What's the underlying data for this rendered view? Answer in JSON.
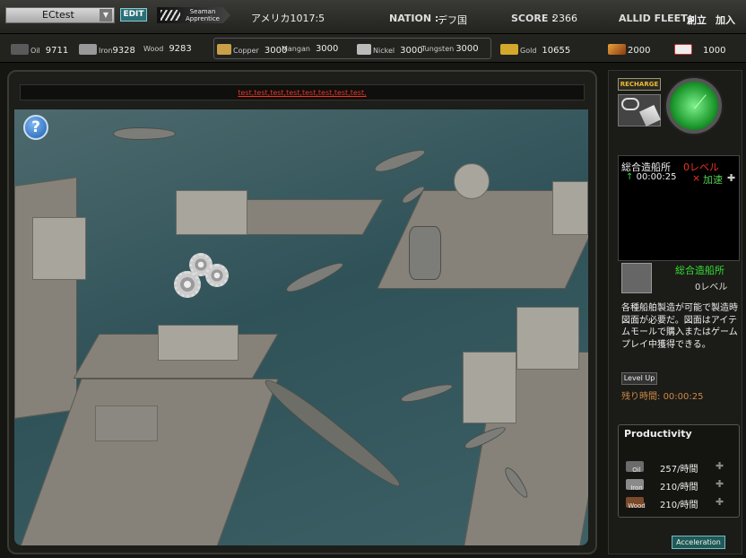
{
  "topbar": {
    "player_name": "ECtest",
    "edit_label": "EDIT",
    "rank_line1": "Seaman",
    "rank_line2": "Apprentice",
    "location": "アメリカ1017:5",
    "nation_label": "NATION :",
    "nation_value": "デフ国",
    "score_label": "SCORE :",
    "score_value": "2366",
    "fleet_label": "ALLID FLEET :",
    "fleet_create": "創立",
    "fleet_join": "加入"
  },
  "resources": {
    "oil": {
      "label": "Oil",
      "value": "9711"
    },
    "iron": {
      "label": "Iron",
      "value": "9328"
    },
    "wood": {
      "label": "Wood",
      "value": "9283"
    },
    "copper": {
      "label": "Copper",
      "value": "3000"
    },
    "mangan": {
      "label": "Mangan",
      "value": "3000"
    },
    "nickel": {
      "label": "Nickel",
      "value": "3000"
    },
    "tungsten": {
      "label": "Tungsten",
      "value": "3000"
    },
    "gold": {
      "label": "Gold",
      "value": "10655"
    },
    "item1_value": "2000",
    "item2_value": "1000"
  },
  "ticker": "test,test,test,test,test,test,test,test,",
  "help_label": "?",
  "panel": {
    "recharge_label": "RECHARGE",
    "queue_name": "総合造船所",
    "queue_level": "0レベル",
    "queue_arrow": "↑",
    "queue_time": "00:00:25",
    "queue_cancel": "×",
    "queue_boost": "加速",
    "queue_plus": "✚",
    "building_name": "総合造船所",
    "building_level": "0レベル",
    "description": "各種船舶製造が可能で製造時図面が必要だ。図面はアイテムモールで購入またはゲームプレイ中獲得できる。",
    "levelup_label": "Level Up",
    "remaining_label": "残り時間:",
    "remaining_time": "00:00:25",
    "productivity_title": "Productivity",
    "productivity": [
      {
        "label": "Oil",
        "value": "257/時間",
        "color": "#6b6b6b"
      },
      {
        "label": "Iron",
        "value": "210/時間",
        "color": "#8a8a8a"
      },
      {
        "label": "Wood",
        "value": "210/時間",
        "color": "#7a4a2a"
      }
    ],
    "acceleration_label": "Acceleration"
  },
  "colors": {
    "ticker_text": "#e32222",
    "accent_green": "#33dd33",
    "gold": "#d4a82a"
  }
}
